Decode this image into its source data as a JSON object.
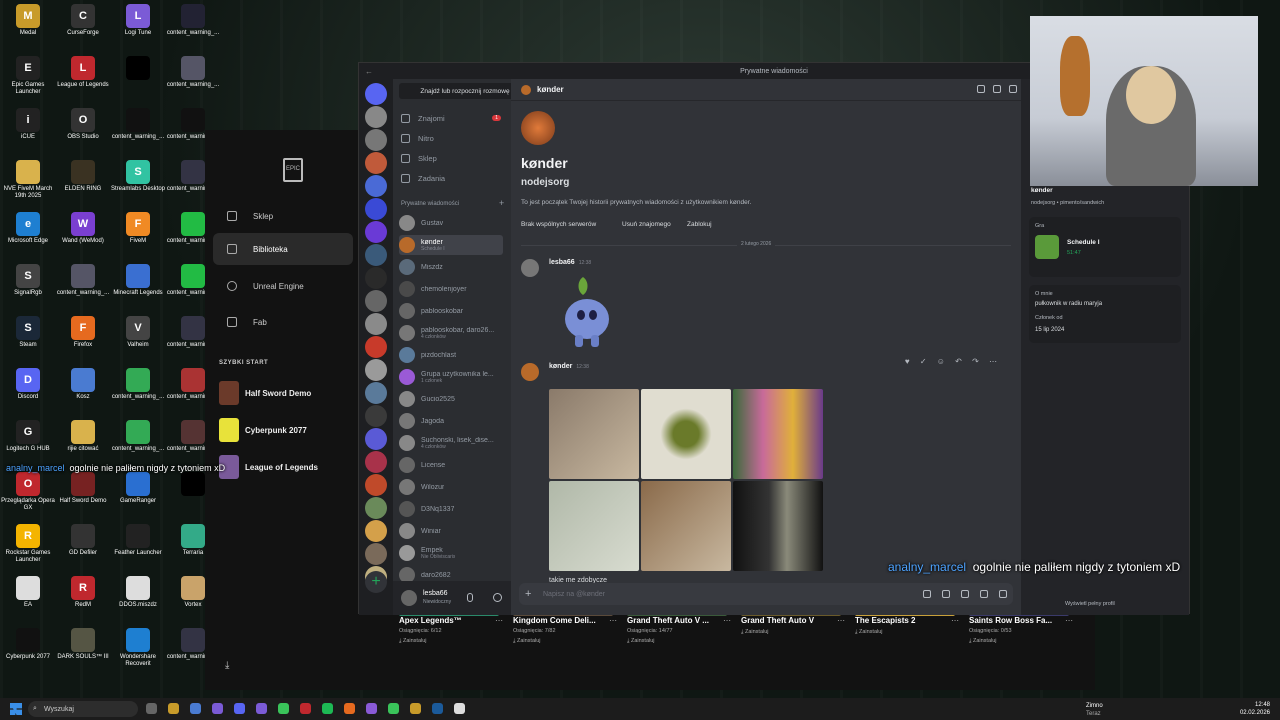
{
  "desktop_icons": [
    {
      "label": "Medal",
      "color": "#c89b2a",
      "glyph": "M"
    },
    {
      "label": "CurseForge",
      "color": "#333",
      "glyph": "C"
    },
    {
      "label": "Logi Tune",
      "color": "#7b5bd6",
      "glyph": "L"
    },
    {
      "label": "content_warning_...",
      "color": "#223",
      "glyph": ""
    },
    {
      "label": "Epic Games Launcher",
      "color": "#222",
      "glyph": "E"
    },
    {
      "label": "League of Legends",
      "color": "#c0282e",
      "glyph": "L"
    },
    {
      "label": "",
      "color": "#000",
      "glyph": ""
    },
    {
      "label": "content_warning_...",
      "color": "#556",
      "glyph": ""
    },
    {
      "label": "iCUE",
      "color": "#222",
      "glyph": "i"
    },
    {
      "label": "OBS Studio",
      "color": "#333",
      "glyph": "O"
    },
    {
      "label": "content_warning_...",
      "color": "#111",
      "glyph": ""
    },
    {
      "label": "content_warning_...",
      "color": "#111",
      "glyph": ""
    },
    {
      "label": "NVE FiveM March 19th 2025",
      "color": "#d9b24c",
      "glyph": ""
    },
    {
      "label": "ELDEN RING",
      "color": "#3a3222",
      "glyph": ""
    },
    {
      "label": "Streamlabs Desktop",
      "color": "#31c3a2",
      "glyph": "S"
    },
    {
      "label": "content_warning_...",
      "color": "#334",
      "glyph": ""
    },
    {
      "label": "Microsoft Edge",
      "color": "#1e7fd1",
      "glyph": "e"
    },
    {
      "label": "Wand (WeMod)",
      "color": "#7a3fd1",
      "glyph": "W"
    },
    {
      "label": "FiveM",
      "color": "#f08a24",
      "glyph": "F"
    },
    {
      "label": "content_warning_...",
      "color": "#2b4",
      "glyph": ""
    },
    {
      "label": "SignalRgb",
      "color": "#444",
      "glyph": "S"
    },
    {
      "label": "content_warning_...",
      "color": "#556",
      "glyph": ""
    },
    {
      "label": "Minecraft Legends",
      "color": "#3a6fd1",
      "glyph": ""
    },
    {
      "label": "content_warning_...",
      "color": "#2b4",
      "glyph": ""
    },
    {
      "label": "Steam",
      "color": "#1b2838",
      "glyph": "S"
    },
    {
      "label": "Firefox",
      "color": "#e66a1f",
      "glyph": "F"
    },
    {
      "label": "Valheim",
      "color": "#444",
      "glyph": "V"
    },
    {
      "label": "content_warning_...",
      "color": "#334",
      "glyph": ""
    },
    {
      "label": "Discord",
      "color": "#5865f2",
      "glyph": "D"
    },
    {
      "label": "Kosz",
      "color": "#4a7bd1",
      "glyph": ""
    },
    {
      "label": "content_warning_...",
      "color": "#3a5",
      "glyph": ""
    },
    {
      "label": "content_warning_...",
      "color": "#a33",
      "glyph": ""
    },
    {
      "label": "Logitech G HUB",
      "color": "#222",
      "glyph": "G"
    },
    {
      "label": "rijie citować",
      "color": "#d9b24c",
      "glyph": ""
    },
    {
      "label": "content_warning_...",
      "color": "#3a5",
      "glyph": ""
    },
    {
      "label": "content_warning_...",
      "color": "#533",
      "glyph": ""
    },
    {
      "label": "Przeglądarka Opera GX",
      "color": "#c0282e",
      "glyph": "O"
    },
    {
      "label": "Half Sword Demo",
      "color": "#722",
      "glyph": ""
    },
    {
      "label": "GameRanger",
      "color": "#2a6fd1",
      "glyph": ""
    },
    {
      "label": "",
      "color": "#000",
      "glyph": ""
    },
    {
      "label": "Rockstar Games Launcher",
      "color": "#f4b400",
      "glyph": "R"
    },
    {
      "label": "GD Defiler",
      "color": "#333",
      "glyph": ""
    },
    {
      "label": "Feather Launcher",
      "color": "#222",
      "glyph": ""
    },
    {
      "label": "Terraria",
      "color": "#3a8",
      "glyph": ""
    },
    {
      "label": "EA",
      "color": "#ddd",
      "glyph": ""
    },
    {
      "label": "RedM",
      "color": "#c0282e",
      "glyph": "R"
    },
    {
      "label": "DDOS.miszdz",
      "color": "#ddd",
      "glyph": ""
    },
    {
      "label": "Vortex",
      "color": "#c9a36a",
      "glyph": ""
    },
    {
      "label": "Cyberpunk 2077",
      "color": "#111",
      "glyph": ""
    },
    {
      "label": "DARK SOULS™ III",
      "color": "#554",
      "glyph": ""
    },
    {
      "label": "Wondershare Recoverit",
      "color": "#1e7fd1",
      "glyph": ""
    },
    {
      "label": "content_warning_...",
      "color": "#334",
      "glyph": ""
    }
  ],
  "epic": {
    "nav": [
      {
        "label": "Sklep",
        "active": false
      },
      {
        "label": "Biblioteka",
        "active": true
      },
      {
        "label": "Unreal Engine",
        "active": false
      },
      {
        "label": "Fab",
        "active": false
      }
    ],
    "quick_start_title": "SZYBKI START",
    "quick_start": [
      {
        "label": "Half Sword Demo",
        "color": "#6b3a2a"
      },
      {
        "label": "Cyberpunk 2077",
        "color": "#e8e23a"
      },
      {
        "label": "League of Legends",
        "color": "#7a5a9a"
      }
    ],
    "library": [
      {
        "title": "Apex Legends™",
        "ach": "Osiągnięcia: 6/12",
        "install": "Zainstaluj",
        "color": "#2a8a6a"
      },
      {
        "title": "Kingdom Come Deli...",
        "ach": "Osiągnięcia: 7/82",
        "install": "Zainstaluj",
        "color": "#5a4a3a"
      },
      {
        "title": "Grand Theft Auto V ...",
        "ach": "Osiągnięcia: 14/77",
        "install": "Zainstaluj",
        "color": "#3a5a3a"
      },
      {
        "title": "Grand Theft Auto V",
        "ach": "",
        "install": "Zainstaluj",
        "color": "#6a5a2a"
      },
      {
        "title": "The Escapists 2",
        "ach": "",
        "install": "Zainstaluj",
        "color": "#c8a03a"
      },
      {
        "title": "Saints Row Boss Fa...",
        "ach": "Osiągnięcia: 0/53",
        "install": "Zainstaluj",
        "color": "#3a3a6a"
      }
    ]
  },
  "discord": {
    "window_title": "Prywatne wiadomości",
    "search_placeholder": "Znajdź lub rozpocznij rozmowę",
    "nav": [
      {
        "label": "Znajomi",
        "badge": "1"
      },
      {
        "label": "Nitro",
        "badge": ""
      },
      {
        "label": "Sklep",
        "badge": ""
      },
      {
        "label": "Zadania",
        "badge": ""
      }
    ],
    "dm_header": "Prywatne wiadomości",
    "dms": [
      {
        "name": "Gustav",
        "sub": "",
        "color": "#888"
      },
      {
        "name": "kønder",
        "sub": "Schedule I",
        "color": "#b86a2a",
        "selected": true
      },
      {
        "name": "Miszdz",
        "sub": "",
        "color": "#5a6a7a"
      },
      {
        "name": "chemolenjoyer",
        "sub": "",
        "color": "#4a4a4a"
      },
      {
        "name": "pablooskobar",
        "sub": "",
        "color": "#666"
      },
      {
        "name": "pablooskobar, daro26...",
        "sub": "4 członków",
        "color": "#777"
      },
      {
        "name": "pizdochlast",
        "sub": "",
        "color": "#5a7a9a"
      },
      {
        "name": "Grupa użytkownika le...",
        "sub": "1 członek",
        "color": "#9a5ad6"
      },
      {
        "name": "Gucio2525",
        "sub": "",
        "color": "#888"
      },
      {
        "name": "Jagoda",
        "sub": "",
        "color": "#777"
      },
      {
        "name": "Suchonski, lisek_dise...",
        "sub": "4 członków",
        "color": "#888"
      },
      {
        "name": "License",
        "sub": "",
        "color": "#666"
      },
      {
        "name": "Wilozur",
        "sub": "",
        "color": "#777"
      },
      {
        "name": "D3Nq1337",
        "sub": "",
        "color": "#555"
      },
      {
        "name": "Winiar",
        "sub": "",
        "color": "#888"
      },
      {
        "name": "Empek",
        "sub": "Nie Obliviscaris",
        "color": "#999"
      },
      {
        "name": "daro2682",
        "sub": "",
        "color": "#666"
      }
    ],
    "user": {
      "name": "lesba66",
      "status": "Niewidoczny"
    },
    "chat": {
      "recipient": "kønder",
      "intro_name": "kønder",
      "intro_user": "nodejsorg",
      "intro_text": "To jest początek Twojej historii prywatnych wiadomości z użytkownikiem kønder.",
      "no_servers": "Brak wspólnych serwerów",
      "remove_friend": "Usuń znajomego",
      "block": "Zablokuj",
      "date_divider": "2 lutego 2026",
      "msg1_author": "lesba66",
      "msg1_time": "12:38",
      "msg2_author": "kønder",
      "msg2_time": "12:38",
      "msg2_text": "takie me zdobycze",
      "composer_placeholder": "Napisz na @kønder"
    },
    "profile": {
      "name": "kønder",
      "tagline": "nodejsorg • pimento/sandwich",
      "activity_label": "Gra",
      "activity_name": "Schedule I",
      "activity_time": "51:47",
      "about_label": "O mnie",
      "about_text": "pułkownik w radiu maryja",
      "member_since_label": "Członek od",
      "member_since": "15 lip 2024",
      "view_full": "Wyświetl pełny profil"
    }
  },
  "overlay": {
    "left_user": "analny_marcel",
    "left_msg": "ogolnie nie paliłem nigdy z tytoniem xD",
    "right_user": "analny_marcel",
    "right_msg": "ogolnie nie paliłem nigdy z tytoniem xD"
  },
  "taskbar": {
    "search": "Wyszukaj",
    "weather": "Zimno",
    "weather_sub": "Teraz",
    "time": "12:48",
    "date": "02.02.2026"
  }
}
